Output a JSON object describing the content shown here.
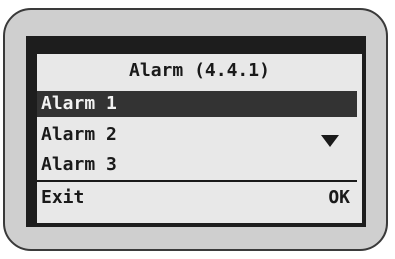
{
  "screen": {
    "title": "Alarm (4.4.1)",
    "items": [
      {
        "label": "Alarm 1",
        "selected": true
      },
      {
        "label": "Alarm 2",
        "selected": false
      },
      {
        "label": "Alarm 3",
        "selected": false
      }
    ],
    "scroll_icon": "down-triangle-icon",
    "softkeys": {
      "left": "Exit",
      "right": "OK"
    }
  },
  "colors": {
    "lcd_background": "#e8e8e8",
    "text": "#1a1a1a",
    "selection_background": "#333333",
    "selection_text": "#f2f2f2",
    "bezel": "#1d1d1d",
    "device_body": "#cfcfcf"
  }
}
